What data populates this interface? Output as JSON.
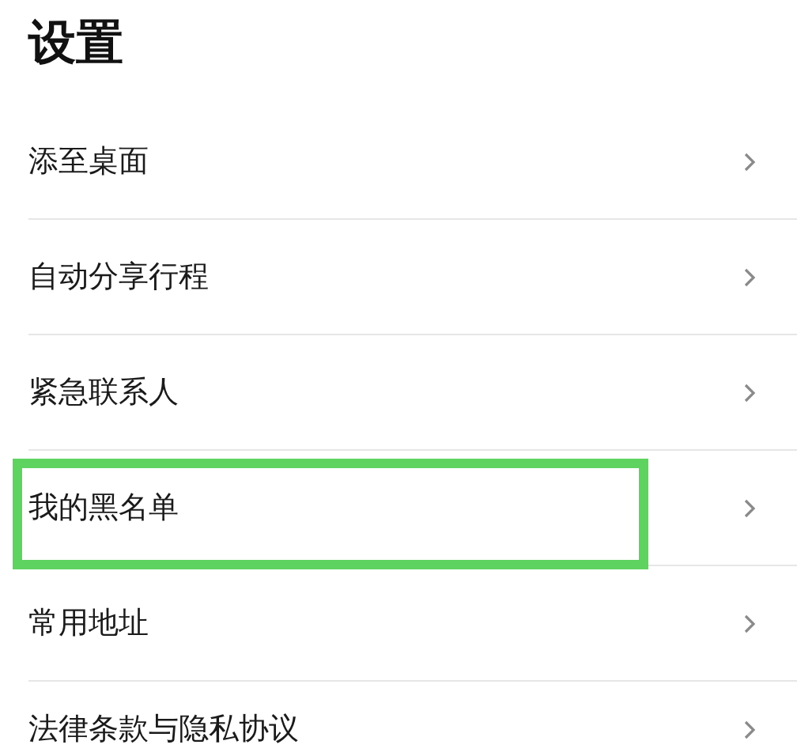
{
  "title": "设置",
  "items": [
    {
      "label": "添至桌面",
      "highlighted": false
    },
    {
      "label": "自动分享行程",
      "highlighted": false
    },
    {
      "label": "紧急联系人",
      "highlighted": false
    },
    {
      "label": "我的黑名单",
      "highlighted": true
    },
    {
      "label": "常用地址",
      "highlighted": false
    },
    {
      "label": "法律条款与隐私协议",
      "highlighted": false
    }
  ]
}
